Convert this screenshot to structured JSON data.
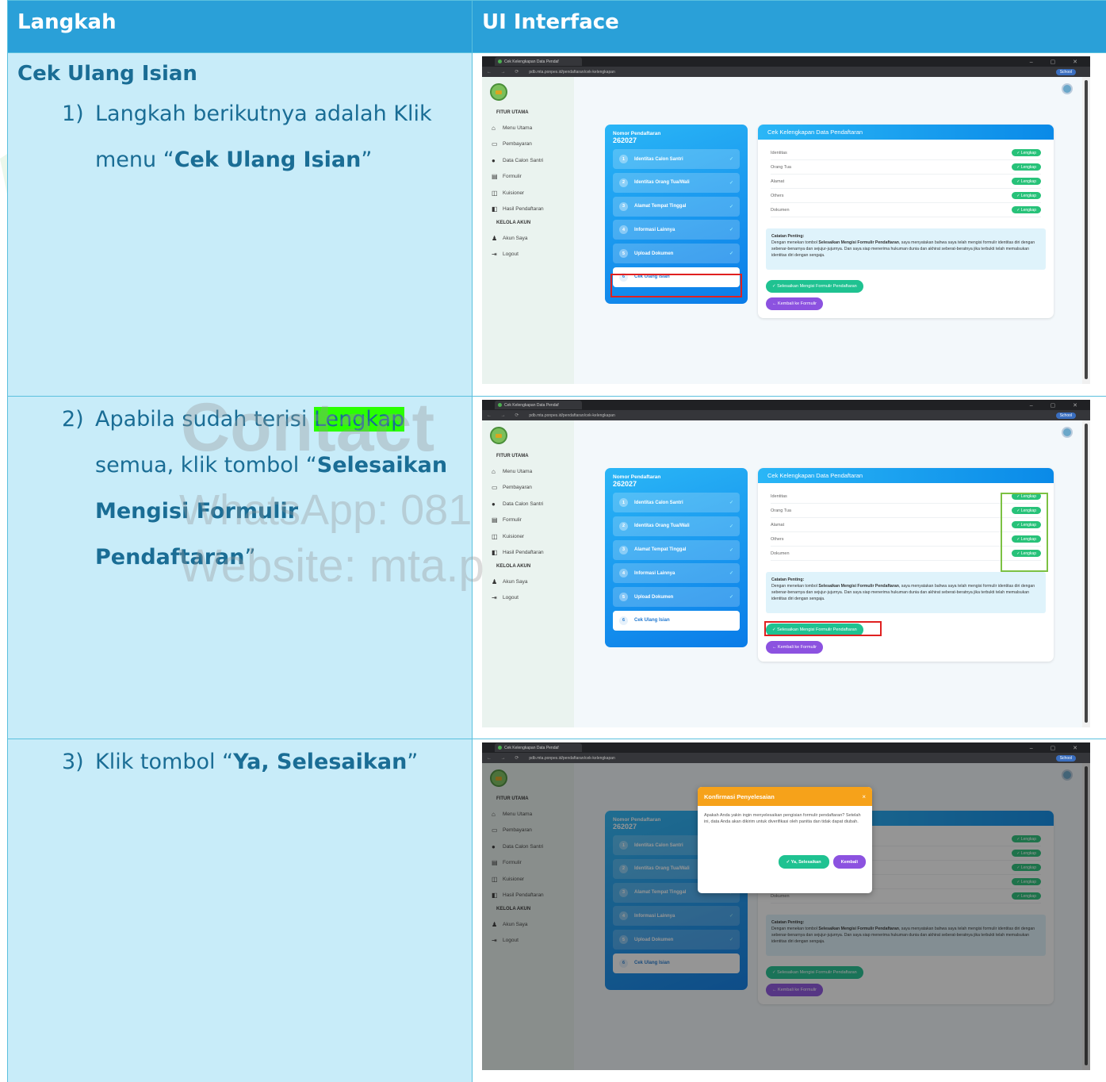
{
  "table": {
    "header_steps": "Langkah",
    "header_ui": "UI Interface"
  },
  "rows": [
    {
      "title": "Cek Ulang Isian",
      "number": "1)",
      "text_a": "Langkah berikutnya adalah Klik",
      "text_b_prefix": "menu “",
      "text_b_bold": "Cek Ulang Isian",
      "text_b_suffix": "”"
    },
    {
      "number": "2)",
      "text_a_prefix": "Apabila sudah terisi ",
      "text_a_highlight": "Lengkap",
      "text_b_prefix": "semua, klik tombol “",
      "text_b_bold": "Selesaikan",
      "text_c_bold": "Mengisi Formulir Pendaftaran",
      "text_c_suffix": "”"
    },
    {
      "number": "3)",
      "text_prefix": "Klik tombol “",
      "text_bold": "Ya, Selesaikan",
      "text_suffix": "”"
    }
  ],
  "watermark": {
    "line1": "Contact",
    "line2": "WhatsApp: 081",
    "line3": "Website: mta.p"
  },
  "browser": {
    "tab_title": "Cek Kelengkapan Data Pendaf",
    "url": "pdb.mta.ponpes.id/pendaftaran/cek-kelengkapan",
    "profile": "School"
  },
  "sidebar": {
    "section_main": "FITUR UTAMA",
    "items": [
      "Menu Utama",
      "Pembayaran",
      "Data Calon Santri",
      "Formulir",
      "Kuisioner",
      "Hasil Pendaftaran"
    ],
    "section_account": "KELOLA AKUN",
    "account_items": [
      "Akun Saya",
      "Logout"
    ]
  },
  "steps_card": {
    "label": "Nomor Pendaftaran",
    "value": "262027",
    "steps": [
      {
        "num": "1",
        "label": "Identitas Calon Santri"
      },
      {
        "num": "2",
        "label": "Identitas Orang Tua/Wali"
      },
      {
        "num": "3",
        "label": "Alamat Tempat Tinggal"
      },
      {
        "num": "4",
        "label": "Informasi Lainnya"
      },
      {
        "num": "5",
        "label": "Upload Dokumen"
      },
      {
        "num": "6",
        "label": "Cek Ulang Isian"
      }
    ]
  },
  "detail_card": {
    "title": "Cek Kelengkapan Data Pendaftaran",
    "rows": [
      "Identitas",
      "Orang Tua",
      "Alamat",
      "Others",
      "Dokumen"
    ],
    "badge": "✓ Lengkap",
    "note_title": "Catatan Penting:",
    "note_a": "Dengan menekan tombol ",
    "note_bold": "Selesaikan Mengisi Formulir Pendaftaran",
    "note_b": ", saya menyatakan bahwa saya telah mengisi formulir identitas diri dengan sebenar-benarnya dan sejujur-jujurnya. Dan saya siap menerima hukuman dunia dan akhirat seberat-beratnya jika terbukti telah memalsukan identitas diri dengan sengaja.",
    "finish_button": "✓ Selesaikan Mengisi Formulir Pendaftaran",
    "back_button": "← Kembali ke Formulir"
  },
  "modal": {
    "title": "Konfirmasi Penyelesaian",
    "close": "×",
    "body": "Apakah Anda yakin ingin menyelesaikan pengisian formulir pendaftaran? Setelah ini, data Anda akan dikirim untuk diverifikasi oleh panitia dan tidak dapat diubah.",
    "confirm": "✓ Ya, Selesaikan",
    "cancel": "Kembali"
  }
}
